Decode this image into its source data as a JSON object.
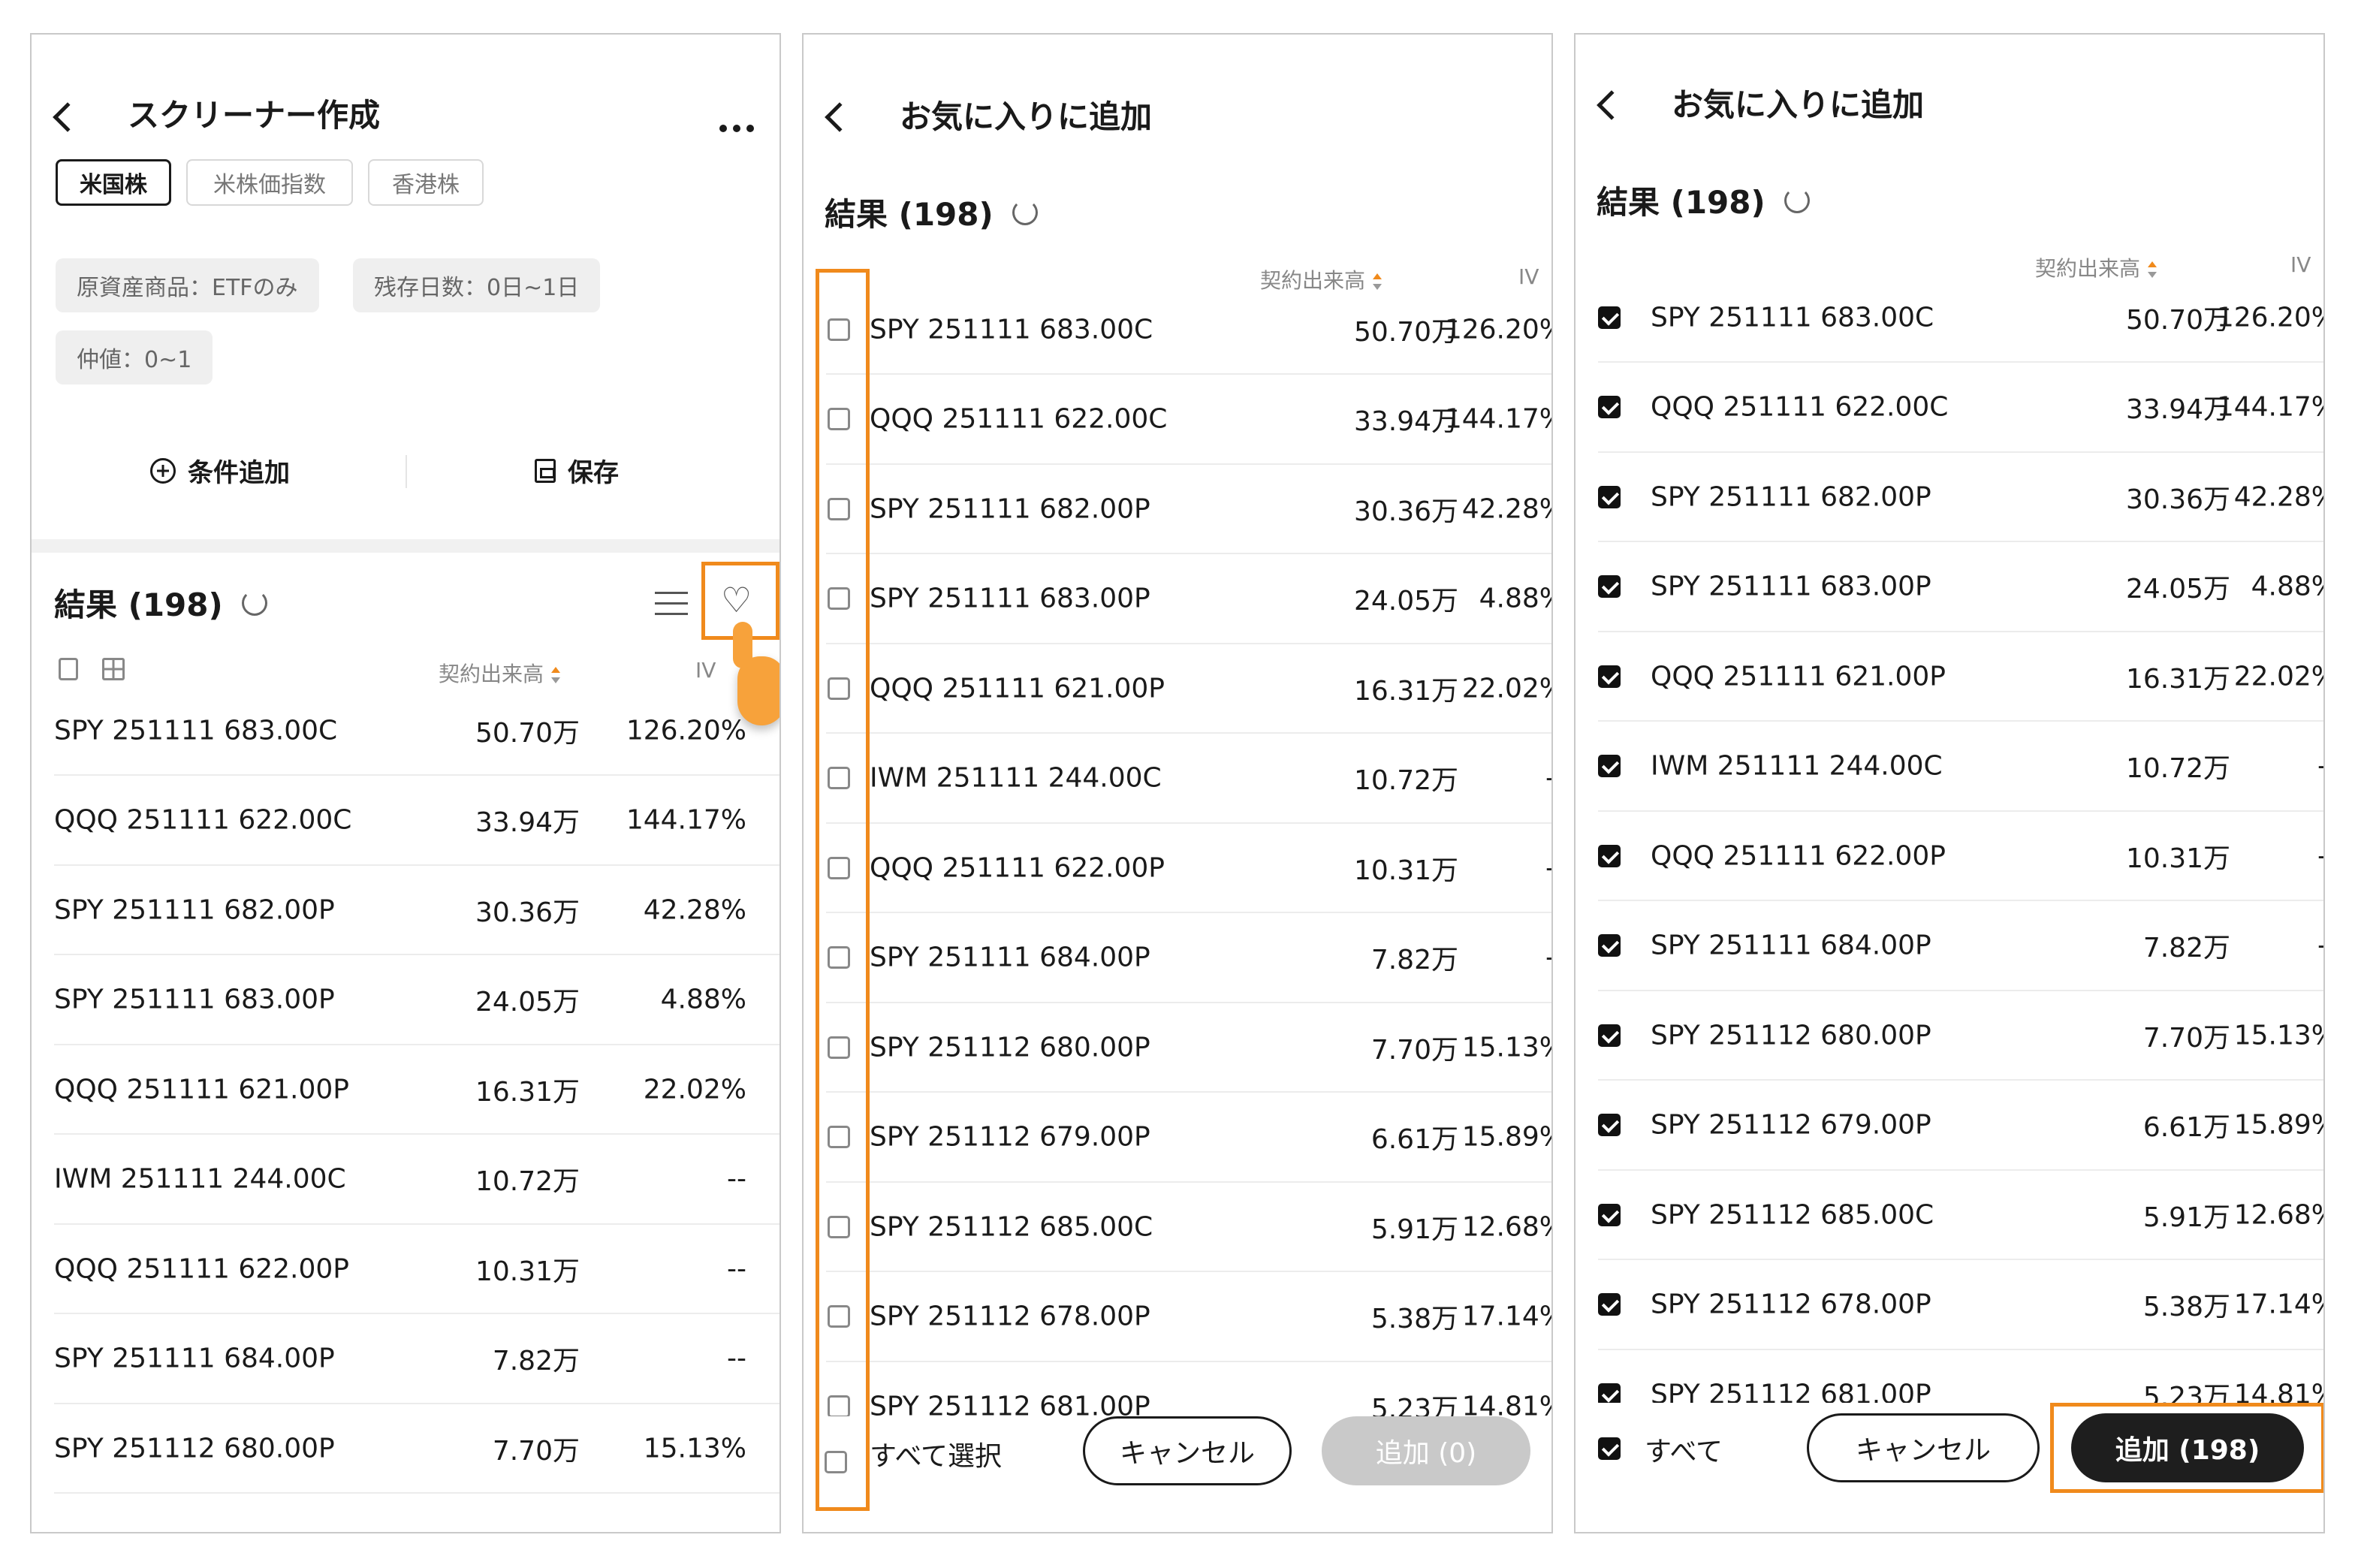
{
  "panel1": {
    "header": {
      "title": "スクリーナー作成"
    },
    "tabs": [
      {
        "label": "米国株",
        "active": true
      },
      {
        "label": "米株価指数",
        "active": false
      },
      {
        "label": "香港株",
        "active": false
      }
    ],
    "filters": [
      "原資産商品：ETFのみ",
      "残存日数：0日~1日",
      "仲値：0~1"
    ],
    "actions": {
      "add_condition": "条件追加",
      "save": "保存"
    },
    "results_title": "結果 (198)",
    "columns": {
      "volume": "契約出来高",
      "iv": "IV"
    },
    "rows": [
      {
        "name": "SPY 251111 683.00C",
        "vol": "50.70万",
        "iv": "126.20%"
      },
      {
        "name": "QQQ 251111 622.00C",
        "vol": "33.94万",
        "iv": "144.17%"
      },
      {
        "name": "SPY 251111 682.00P",
        "vol": "30.36万",
        "iv": "42.28%"
      },
      {
        "name": "SPY 251111 683.00P",
        "vol": "24.05万",
        "iv": "4.88%"
      },
      {
        "name": "QQQ 251111 621.00P",
        "vol": "16.31万",
        "iv": "22.02%"
      },
      {
        "name": "IWM 251111 244.00C",
        "vol": "10.72万",
        "iv": "--"
      },
      {
        "name": "QQQ 251111 622.00P",
        "vol": "10.31万",
        "iv": "--"
      },
      {
        "name": "SPY 251111 684.00P",
        "vol": "7.82万",
        "iv": "--"
      },
      {
        "name": "SPY 251112 680.00P",
        "vol": "7.70万",
        "iv": "15.13%"
      }
    ]
  },
  "panel2": {
    "header": {
      "title": "お気に入りに追加"
    },
    "results_title": "結果 (198)",
    "columns": {
      "volume": "契約出来高",
      "iv": "IV"
    },
    "rows": [
      {
        "name": "SPY 251111 683.00C",
        "vol": "50.70万",
        "iv": "126.20%"
      },
      {
        "name": "QQQ 251111 622.00C",
        "vol": "33.94万",
        "iv": "144.17%"
      },
      {
        "name": "SPY 251111 682.00P",
        "vol": "30.36万",
        "iv": "42.28%"
      },
      {
        "name": "SPY 251111 683.00P",
        "vol": "24.05万",
        "iv": "4.88%"
      },
      {
        "name": "QQQ 251111 621.00P",
        "vol": "16.31万",
        "iv": "22.02%"
      },
      {
        "name": "IWM 251111 244.00C",
        "vol": "10.72万",
        "iv": "--"
      },
      {
        "name": "QQQ 251111 622.00P",
        "vol": "10.31万",
        "iv": "--"
      },
      {
        "name": "SPY 251111 684.00P",
        "vol": "7.82万",
        "iv": "--"
      },
      {
        "name": "SPY 251112 680.00P",
        "vol": "7.70万",
        "iv": "15.13%"
      },
      {
        "name": "SPY 251112 679.00P",
        "vol": "6.61万",
        "iv": "15.89%"
      },
      {
        "name": "SPY 251112 685.00C",
        "vol": "5.91万",
        "iv": "12.68%"
      },
      {
        "name": "SPY 251112 678.00P",
        "vol": "5.38万",
        "iv": "17.14%"
      },
      {
        "name": "SPY 251112 681.00P",
        "vol": "5.23万",
        "iv": "14.81%"
      }
    ],
    "footer": {
      "select_all": "すべて選択",
      "cancel": "キャンセル",
      "add": "追加 (0)"
    }
  },
  "panel3": {
    "header": {
      "title": "お気に入りに追加"
    },
    "results_title": "結果 (198)",
    "columns": {
      "volume": "契約出来高",
      "iv": "IV"
    },
    "rows": [
      {
        "name": "SPY 251111 683.00C",
        "vol": "50.70万",
        "iv": "126.20%"
      },
      {
        "name": "QQQ 251111 622.00C",
        "vol": "33.94万",
        "iv": "144.17%"
      },
      {
        "name": "SPY 251111 682.00P",
        "vol": "30.36万",
        "iv": "42.28%"
      },
      {
        "name": "SPY 251111 683.00P",
        "vol": "24.05万",
        "iv": "4.88%"
      },
      {
        "name": "QQQ 251111 621.00P",
        "vol": "16.31万",
        "iv": "22.02%"
      },
      {
        "name": "IWM 251111 244.00C",
        "vol": "10.72万",
        "iv": "--"
      },
      {
        "name": "QQQ 251111 622.00P",
        "vol": "10.31万",
        "iv": "--"
      },
      {
        "name": "SPY 251111 684.00P",
        "vol": "7.82万",
        "iv": "--"
      },
      {
        "name": "SPY 251112 680.00P",
        "vol": "7.70万",
        "iv": "15.13%"
      },
      {
        "name": "SPY 251112 679.00P",
        "vol": "6.61万",
        "iv": "15.89%"
      },
      {
        "name": "SPY 251112 685.00C",
        "vol": "5.91万",
        "iv": "12.68%"
      },
      {
        "name": "SPY 251112 678.00P",
        "vol": "5.38万",
        "iv": "17.14%"
      },
      {
        "name": "SPY 251112 681.00P",
        "vol": "5.23万",
        "iv": "14.81%"
      }
    ],
    "footer": {
      "select_all": "すべて",
      "cancel": "キャンセル",
      "add": "追加 (198)"
    }
  },
  "colors": {
    "highlight": "#f08a1c",
    "dark_button": "#1e1e1e",
    "disabled_button": "#c9c9c9"
  },
  "icons": [
    "back-arrow-icon",
    "more-icon",
    "plus-circle-icon",
    "save-icon",
    "refresh-icon",
    "list-icon",
    "heart-plus-icon",
    "copy-icon",
    "grid-icon",
    "sort-icon",
    "checkbox-icon",
    "pointer-hand-icon"
  ]
}
